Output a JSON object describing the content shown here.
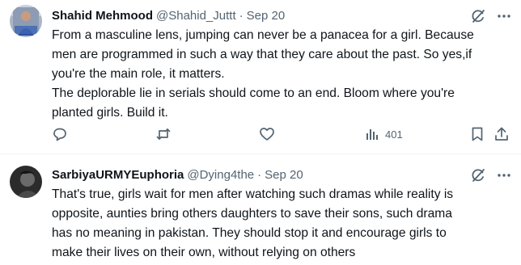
{
  "tweets": [
    {
      "author_name": "Shahid Mehmood",
      "handle": "@Shahid_Juttt",
      "separator": "·",
      "date": "Sep 20",
      "text": "From a masculine lens, jumping can never be a panacea for a girl. Because\nmen are programmed in such a way that they care about the past. So yes,if\nyou're the main role, it matters.\nThe deplorable lie in serials should come to an end. Bloom where you're\nplanted girls. Build it.",
      "views": "401"
    },
    {
      "author_name": "SarbiyaURMYEuphoria",
      "handle": "@Dying4the",
      "separator": "·",
      "date": "Sep 20",
      "text": "That's true, girls wait for men after watching such dramas while reality is\nopposite, aunties bring others daughters to save their sons, such drama\nhas no meaning in pakistan. They should stop it and encourage girls to\nmake their lives on their own, without relying on others"
    }
  ],
  "icons": [
    "grok-icon",
    "more-icon",
    "reply-icon",
    "retweet-icon",
    "like-icon",
    "views-icon",
    "bookmark-icon",
    "share-icon"
  ],
  "colors": {
    "text": "#0f1419",
    "secondary": "#536471",
    "divider": "#eff3f4"
  }
}
